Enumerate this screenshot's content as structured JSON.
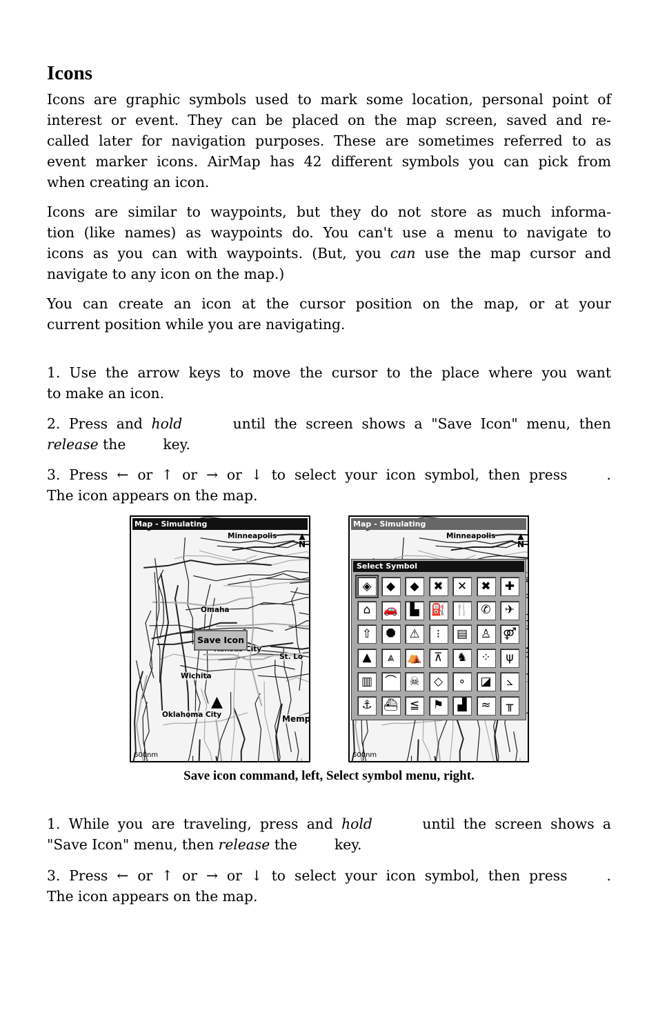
{
  "heading": "Icons",
  "p1": [
    "Icons are graphic symbols used to mark some location, personal point of",
    "interest or event. They can be placed on the map screen, saved and re-",
    "called later for navigation purposes. These are sometimes referred to as",
    "event marker icons. AirMap has 42 different symbols you can pick from",
    "when creating an icon."
  ],
  "p2": {
    "l1": "Icons are similar to waypoints, but they do not store as much informa-",
    "l2": "tion (like names) as waypoints do. You can't use a menu to navigate to",
    "l3a": "icons as you can with waypoints. (But, you ",
    "l3b": "can",
    "l3c": " use the map cursor and",
    "l4": "navigate to any icon on the map.)"
  },
  "p3": [
    "You can create an icon at the cursor position on the map, or at your",
    "current position while you are navigating."
  ],
  "stepsA": {
    "s1": [
      "1. Use the arrow keys to move the cursor to the place where you want",
      "to make an icon."
    ],
    "s2": {
      "a": "2. Press and ",
      "hold": "hold",
      "b": "until the screen shows a \"Save Icon\" menu, then",
      "release": "release",
      "c": " the",
      "d": "key."
    },
    "s3": {
      "a": "3. Press ← or ↑ or → or ↓ to select your icon symbol, then press",
      "b": ".",
      "c": "The icon appears on the map."
    }
  },
  "stepsB": {
    "s1": {
      "a": "1. While you are traveling, press and ",
      "hold": "hold",
      "b": "until the screen shows a",
      "c": "\"Save Icon\" menu, then ",
      "release": "release",
      "d": " the",
      "e": "key."
    },
    "s3": {
      "a": "3. Press ← or ↑ or → or ↓ to select your icon symbol, then press",
      "b": ".",
      "c": "The icon appears on the map."
    }
  },
  "left_screen": {
    "title": "Map - Simulating",
    "cities": {
      "minneapolis": "Minneapolis",
      "omaha": "Omaha",
      "kansas": "Kansas City",
      "stlouis": "St. Lo",
      "wichita": "Wichita",
      "okc": "Oklahoma City",
      "memphis": "Memp"
    },
    "north": "N",
    "scale": "600nm",
    "popup": "Save Icon"
  },
  "right_screen": {
    "title": "Map - Simulating",
    "city": "Minneapolis",
    "north": "N",
    "scale": "600nm",
    "menu_title": "Select Symbol",
    "symbols": [
      {
        "name": "diamond-quartered",
        "glyph": "◈"
      },
      {
        "name": "diamond-half",
        "glyph": "◆"
      },
      {
        "name": "diamond-split",
        "glyph": "◆"
      },
      {
        "name": "x-bold",
        "glyph": "✖"
      },
      {
        "name": "x-outline",
        "glyph": "✕"
      },
      {
        "name": "x-gray",
        "glyph": "✖"
      },
      {
        "name": "cross",
        "glyph": "✚"
      },
      {
        "name": "house",
        "glyph": "⌂"
      },
      {
        "name": "car",
        "glyph": "🚗"
      },
      {
        "name": "store",
        "glyph": "▙"
      },
      {
        "name": "fuel",
        "glyph": "⛽"
      },
      {
        "name": "restaurant",
        "glyph": "🍴"
      },
      {
        "name": "phone",
        "glyph": "✆"
      },
      {
        "name": "airport",
        "glyph": "✈"
      },
      {
        "name": "exit",
        "glyph": "⇧"
      },
      {
        "name": "stop",
        "glyph": "⯃"
      },
      {
        "name": "warning",
        "glyph": "⚠"
      },
      {
        "name": "traffic-light",
        "glyph": "⁝"
      },
      {
        "name": "flag",
        "glyph": "▤"
      },
      {
        "name": "person",
        "glyph": "♙"
      },
      {
        "name": "restroom",
        "glyph": "⚤"
      },
      {
        "name": "tree",
        "glyph": "▲"
      },
      {
        "name": "mountain",
        "glyph": "⩓"
      },
      {
        "name": "tent",
        "glyph": "⛺"
      },
      {
        "name": "picnic-table",
        "glyph": "⊼"
      },
      {
        "name": "deer",
        "glyph": "♞"
      },
      {
        "name": "tracks",
        "glyph": "⁘"
      },
      {
        "name": "bird-tracks",
        "glyph": "ψ"
      },
      {
        "name": "tower",
        "glyph": "▥"
      },
      {
        "name": "bridge",
        "glyph": "⌒"
      },
      {
        "name": "skull",
        "glyph": "☠"
      },
      {
        "name": "fish",
        "glyph": "◇"
      },
      {
        "name": "fish-school",
        "glyph": "∘"
      },
      {
        "name": "dive-flag",
        "glyph": "◪"
      },
      {
        "name": "wreck",
        "glyph": "⦣"
      },
      {
        "name": "anchor",
        "glyph": "⚓"
      },
      {
        "name": "boat",
        "glyph": "⛴"
      },
      {
        "name": "boat-ramp",
        "glyph": "≦"
      },
      {
        "name": "marker",
        "glyph": "⚑"
      },
      {
        "name": "factory",
        "glyph": "▟"
      },
      {
        "name": "swimmer",
        "glyph": "≈"
      },
      {
        "name": "dock",
        "glyph": "╥"
      }
    ]
  },
  "caption": "Save icon command, left, Select symbol menu, right."
}
